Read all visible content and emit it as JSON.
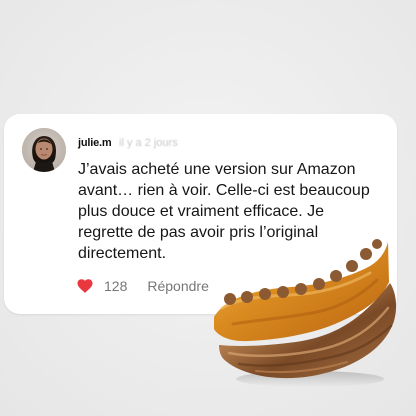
{
  "comment": {
    "username": "julie.m",
    "timestamp": "il y a 2 jours",
    "text": "J’avais acheté une version sur Amazon avant… rien à voir. Celle-ci est beaucoup plus douce et vraiment efficace. Je regrette de pas avoir pris l’original directement.",
    "likes": "128",
    "reply_label": "Répondre"
  },
  "icons": {
    "like": "heart-icon",
    "avatar": "avatar"
  },
  "colors": {
    "heart": "#e9363f",
    "card": "#ffffff",
    "muted_text": "#777777",
    "bristles": "#d98a1f",
    "wood": "#8b5a32"
  }
}
